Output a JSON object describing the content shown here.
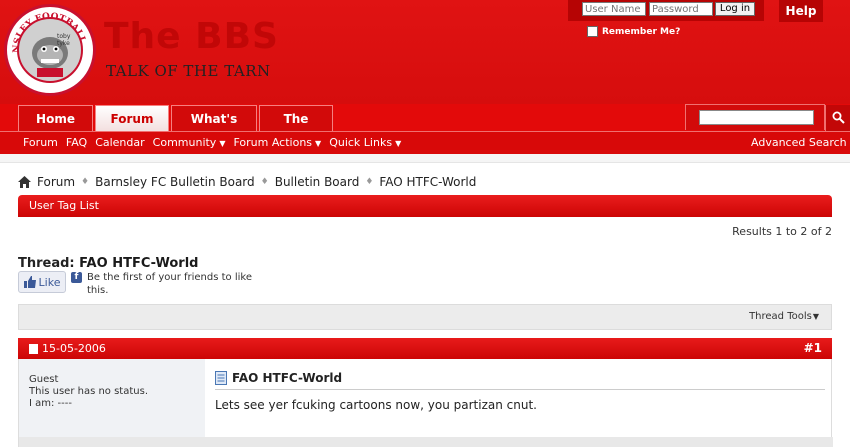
{
  "header": {
    "site_title": "The BBS",
    "site_subtitle": "TALK OF THE TARN",
    "logo_ring_text": "BARNSLEY FOOTBALL CLUB",
    "logo_badge_text": "toby tyke"
  },
  "login": {
    "username_placeholder": "User Name",
    "password_placeholder": "Password",
    "login_label": "Log in",
    "remember_label": "Remember Me?",
    "help_label": "Help"
  },
  "nav": {
    "tabs": [
      {
        "label": "Home"
      },
      {
        "label": "Forum"
      },
      {
        "label": "What's New?"
      },
      {
        "label": "The BBS"
      }
    ],
    "selected_tab": "Forum",
    "subnav": [
      {
        "label": "Forum"
      },
      {
        "label": "FAQ"
      },
      {
        "label": "Calendar"
      },
      {
        "label": "Community",
        "dropdown": true
      },
      {
        "label": "Forum Actions",
        "dropdown": true
      },
      {
        "label": "Quick Links",
        "dropdown": true
      }
    ],
    "advanced_search": "Advanced Search"
  },
  "breadcrumb": [
    "Forum",
    "Barnsley FC Bulletin Board",
    "Bulletin Board",
    "FAO HTFC-World"
  ],
  "section_bar": "User Tag List",
  "results_text": "Results 1 to 2 of 2",
  "thread": {
    "prefix": "Thread:",
    "name": "FAO HTFC-World"
  },
  "facebook": {
    "like_label": "Like",
    "text": "Be the first of your friends to like this."
  },
  "thread_tools": "Thread Tools",
  "post": {
    "date": "15-05-2006",
    "number": "#1",
    "user_lines": [
      "Guest",
      "This user has no status.",
      "I am: ----"
    ],
    "title": "FAO HTFC-World",
    "message": "Lets see yer fcuking cartoons now, you partizan cnut."
  },
  "colors": {
    "brand_red": "#e30a0a",
    "dark_red": "#b60404"
  }
}
